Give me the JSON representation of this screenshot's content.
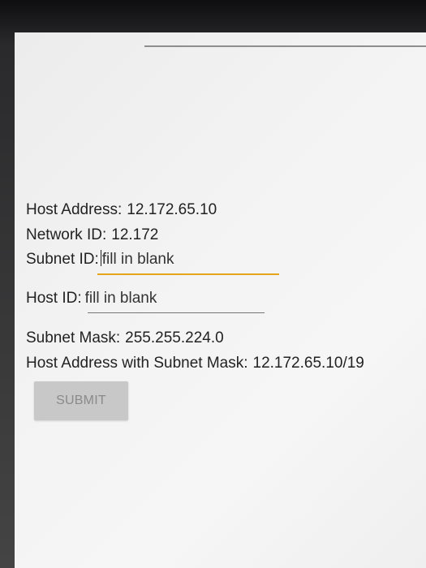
{
  "form": {
    "host_address": {
      "label": "Host Address:",
      "value": "12.172.65.10"
    },
    "network_id": {
      "label": "Network ID:",
      "value": "12.172"
    },
    "subnet_id": {
      "label": "Subnet ID:",
      "placeholder": "fill in blank"
    },
    "host_id": {
      "label": "Host ID:",
      "placeholder": "fill in blank"
    },
    "subnet_mask": {
      "label": "Subnet Mask:",
      "value": "255.255.224.0"
    },
    "host_with_mask": {
      "label": "Host Address with Subnet Mask:",
      "value": "12.172.65.10/19"
    }
  },
  "submit_label": "SUBMIT",
  "colors": {
    "focus_underline": "#e4a51a",
    "button_bg": "#c8c8c8",
    "button_text": "#8a8a8a"
  }
}
